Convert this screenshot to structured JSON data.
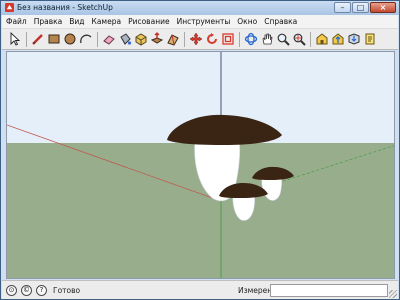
{
  "window": {
    "title": "Без названия - SketchUp",
    "app_icon": "sketchup-logo-icon",
    "buttons": {
      "minimize": "–",
      "maximize": "□",
      "close": "×"
    }
  },
  "menu": [
    "Файл",
    "Правка",
    "Вид",
    "Камера",
    "Рисование",
    "Инструменты",
    "Окно",
    "Справка"
  ],
  "toolbar": {
    "tools": [
      "select-arrow-icon",
      "pencil-line-icon",
      "rectangle-icon",
      "circle-icon",
      "arc-icon",
      "eraser-icon",
      "paint-bucket-icon",
      "make-component-icon",
      "push-pull-icon",
      "follow-me-icon",
      "move-icon",
      "rotate-icon",
      "offset-icon",
      "orbit-icon",
      "pan-icon",
      "zoom-icon",
      "zoom-extents-icon",
      "warehouse-icon",
      "share-model-icon",
      "get-models-icon",
      "extension-icon"
    ]
  },
  "colors": {
    "sky": "#e5eff9",
    "ground": "#97ad8c",
    "cap": "#3a2414",
    "stem": "#ffffff",
    "axis_red": "#c05a52",
    "axis_green": "#3c9b3c"
  },
  "status": {
    "text": "Готово",
    "measure_label": "Измерения",
    "measure_value": "",
    "icons": [
      "geo-location-icon",
      "credits-icon",
      "help-icon"
    ]
  }
}
